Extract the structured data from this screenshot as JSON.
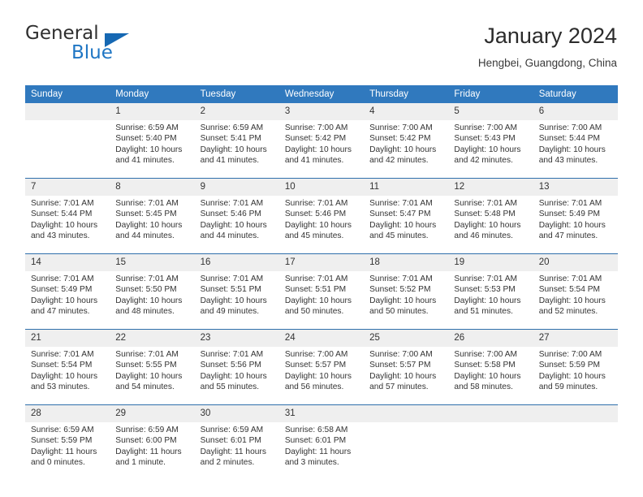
{
  "brand": {
    "name_part1": "General",
    "name_part2": "Blue",
    "accent_color": "#1668b3"
  },
  "header": {
    "title": "January 2024",
    "subtitle": "Hengbei, Guangdong, China",
    "header_bg_color": "#3079be",
    "daynum_bg_color": "#efefef"
  },
  "weekdays": [
    "Sunday",
    "Monday",
    "Tuesday",
    "Wednesday",
    "Thursday",
    "Friday",
    "Saturday"
  ],
  "weeks": [
    [
      {
        "day": "",
        "sunrise": "",
        "sunset": "",
        "daylight": "",
        "empty": true
      },
      {
        "day": "1",
        "sunrise": "Sunrise: 6:59 AM",
        "sunset": "Sunset: 5:40 PM",
        "daylight": "Daylight: 10 hours and 41 minutes."
      },
      {
        "day": "2",
        "sunrise": "Sunrise: 6:59 AM",
        "sunset": "Sunset: 5:41 PM",
        "daylight": "Daylight: 10 hours and 41 minutes."
      },
      {
        "day": "3",
        "sunrise": "Sunrise: 7:00 AM",
        "sunset": "Sunset: 5:42 PM",
        "daylight": "Daylight: 10 hours and 41 minutes."
      },
      {
        "day": "4",
        "sunrise": "Sunrise: 7:00 AM",
        "sunset": "Sunset: 5:42 PM",
        "daylight": "Daylight: 10 hours and 42 minutes."
      },
      {
        "day": "5",
        "sunrise": "Sunrise: 7:00 AM",
        "sunset": "Sunset: 5:43 PM",
        "daylight": "Daylight: 10 hours and 42 minutes."
      },
      {
        "day": "6",
        "sunrise": "Sunrise: 7:00 AM",
        "sunset": "Sunset: 5:44 PM",
        "daylight": "Daylight: 10 hours and 43 minutes."
      }
    ],
    [
      {
        "day": "7",
        "sunrise": "Sunrise: 7:01 AM",
        "sunset": "Sunset: 5:44 PM",
        "daylight": "Daylight: 10 hours and 43 minutes."
      },
      {
        "day": "8",
        "sunrise": "Sunrise: 7:01 AM",
        "sunset": "Sunset: 5:45 PM",
        "daylight": "Daylight: 10 hours and 44 minutes."
      },
      {
        "day": "9",
        "sunrise": "Sunrise: 7:01 AM",
        "sunset": "Sunset: 5:46 PM",
        "daylight": "Daylight: 10 hours and 44 minutes."
      },
      {
        "day": "10",
        "sunrise": "Sunrise: 7:01 AM",
        "sunset": "Sunset: 5:46 PM",
        "daylight": "Daylight: 10 hours and 45 minutes."
      },
      {
        "day": "11",
        "sunrise": "Sunrise: 7:01 AM",
        "sunset": "Sunset: 5:47 PM",
        "daylight": "Daylight: 10 hours and 45 minutes."
      },
      {
        "day": "12",
        "sunrise": "Sunrise: 7:01 AM",
        "sunset": "Sunset: 5:48 PM",
        "daylight": "Daylight: 10 hours and 46 minutes."
      },
      {
        "day": "13",
        "sunrise": "Sunrise: 7:01 AM",
        "sunset": "Sunset: 5:49 PM",
        "daylight": "Daylight: 10 hours and 47 minutes."
      }
    ],
    [
      {
        "day": "14",
        "sunrise": "Sunrise: 7:01 AM",
        "sunset": "Sunset: 5:49 PM",
        "daylight": "Daylight: 10 hours and 47 minutes."
      },
      {
        "day": "15",
        "sunrise": "Sunrise: 7:01 AM",
        "sunset": "Sunset: 5:50 PM",
        "daylight": "Daylight: 10 hours and 48 minutes."
      },
      {
        "day": "16",
        "sunrise": "Sunrise: 7:01 AM",
        "sunset": "Sunset: 5:51 PM",
        "daylight": "Daylight: 10 hours and 49 minutes."
      },
      {
        "day": "17",
        "sunrise": "Sunrise: 7:01 AM",
        "sunset": "Sunset: 5:51 PM",
        "daylight": "Daylight: 10 hours and 50 minutes."
      },
      {
        "day": "18",
        "sunrise": "Sunrise: 7:01 AM",
        "sunset": "Sunset: 5:52 PM",
        "daylight": "Daylight: 10 hours and 50 minutes."
      },
      {
        "day": "19",
        "sunrise": "Sunrise: 7:01 AM",
        "sunset": "Sunset: 5:53 PM",
        "daylight": "Daylight: 10 hours and 51 minutes."
      },
      {
        "day": "20",
        "sunrise": "Sunrise: 7:01 AM",
        "sunset": "Sunset: 5:54 PM",
        "daylight": "Daylight: 10 hours and 52 minutes."
      }
    ],
    [
      {
        "day": "21",
        "sunrise": "Sunrise: 7:01 AM",
        "sunset": "Sunset: 5:54 PM",
        "daylight": "Daylight: 10 hours and 53 minutes."
      },
      {
        "day": "22",
        "sunrise": "Sunrise: 7:01 AM",
        "sunset": "Sunset: 5:55 PM",
        "daylight": "Daylight: 10 hours and 54 minutes."
      },
      {
        "day": "23",
        "sunrise": "Sunrise: 7:01 AM",
        "sunset": "Sunset: 5:56 PM",
        "daylight": "Daylight: 10 hours and 55 minutes."
      },
      {
        "day": "24",
        "sunrise": "Sunrise: 7:00 AM",
        "sunset": "Sunset: 5:57 PM",
        "daylight": "Daylight: 10 hours and 56 minutes."
      },
      {
        "day": "25",
        "sunrise": "Sunrise: 7:00 AM",
        "sunset": "Sunset: 5:57 PM",
        "daylight": "Daylight: 10 hours and 57 minutes."
      },
      {
        "day": "26",
        "sunrise": "Sunrise: 7:00 AM",
        "sunset": "Sunset: 5:58 PM",
        "daylight": "Daylight: 10 hours and 58 minutes."
      },
      {
        "day": "27",
        "sunrise": "Sunrise: 7:00 AM",
        "sunset": "Sunset: 5:59 PM",
        "daylight": "Daylight: 10 hours and 59 minutes."
      }
    ],
    [
      {
        "day": "28",
        "sunrise": "Sunrise: 6:59 AM",
        "sunset": "Sunset: 5:59 PM",
        "daylight": "Daylight: 11 hours and 0 minutes."
      },
      {
        "day": "29",
        "sunrise": "Sunrise: 6:59 AM",
        "sunset": "Sunset: 6:00 PM",
        "daylight": "Daylight: 11 hours and 1 minute."
      },
      {
        "day": "30",
        "sunrise": "Sunrise: 6:59 AM",
        "sunset": "Sunset: 6:01 PM",
        "daylight": "Daylight: 11 hours and 2 minutes."
      },
      {
        "day": "31",
        "sunrise": "Sunrise: 6:58 AM",
        "sunset": "Sunset: 6:01 PM",
        "daylight": "Daylight: 11 hours and 3 minutes."
      },
      {
        "day": "",
        "sunrise": "",
        "sunset": "",
        "daylight": "",
        "empty": true
      },
      {
        "day": "",
        "sunrise": "",
        "sunset": "",
        "daylight": "",
        "empty": true
      },
      {
        "day": "",
        "sunrise": "",
        "sunset": "",
        "daylight": "",
        "empty": true
      }
    ]
  ]
}
